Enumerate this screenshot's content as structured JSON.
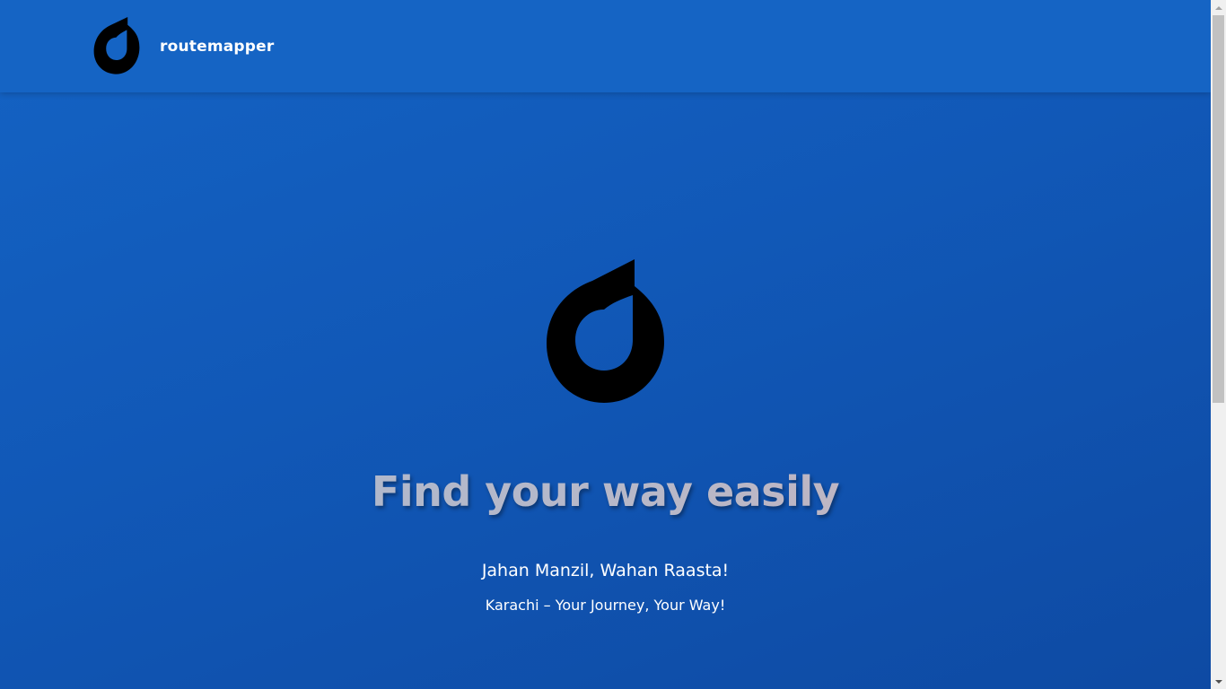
{
  "header": {
    "brand_name": "routemapper",
    "logo_icon": "droplet-d-logo-icon"
  },
  "hero": {
    "logo_icon": "droplet-d-logo-icon",
    "headline": "Find your way easily",
    "tagline": "Jahan Manzil, Wahan Raasta!",
    "subline": "Karachi – Your Journey, Your Way!"
  },
  "colors": {
    "background": "#1463c4",
    "header": "#1564c4",
    "logo": "#000000",
    "text": "#ffffff"
  },
  "scrollbar": {
    "position_fraction": 0.0
  }
}
